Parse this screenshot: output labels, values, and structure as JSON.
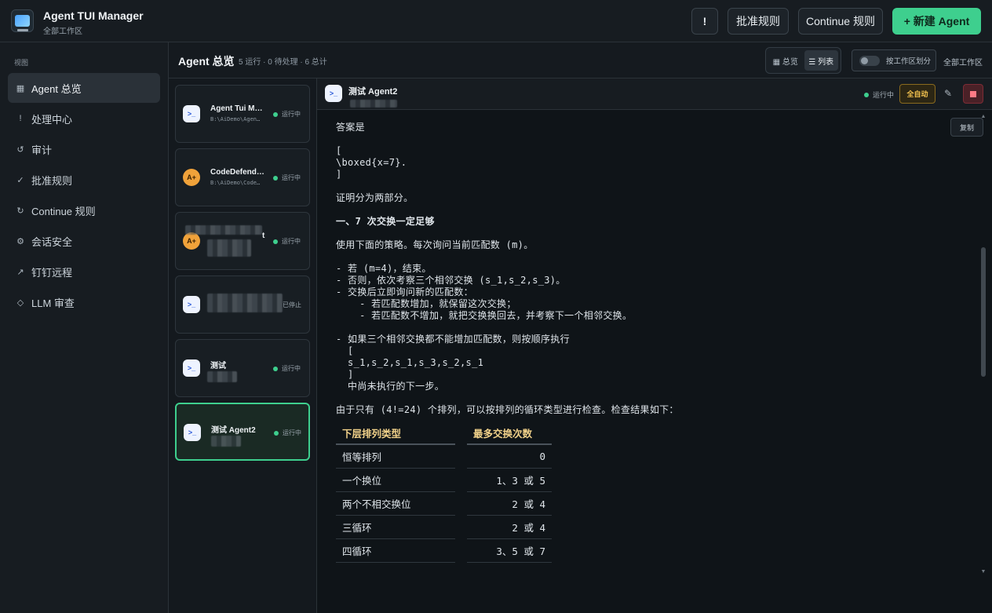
{
  "app": {
    "title": "Agent TUI Manager",
    "subtitle": "全部工作区",
    "logo_icon": "terminal-monitor-icon"
  },
  "topbar": {
    "alert_label": "!",
    "approve_rules_label": "批准规则",
    "continue_rules_label": "Continue 规则",
    "new_agent_label": "+ 新建 Agent",
    "accent": "#3ecf8e"
  },
  "sidebar": {
    "caption": "视图",
    "items": [
      {
        "icon": "▦",
        "label": "Agent 总览",
        "active": true
      },
      {
        "icon": "!",
        "label": "处理中心"
      },
      {
        "icon": "↺",
        "label": "审计"
      },
      {
        "icon": "✓",
        "label": "批准规则"
      },
      {
        "icon": "↻",
        "label": "Continue 规则"
      },
      {
        "icon": "⚙",
        "label": "会话安全"
      },
      {
        "icon": "↗",
        "label": "钉钉远程"
      },
      {
        "icon": "◇",
        "label": "LLM 审查"
      }
    ]
  },
  "list_header": {
    "title": "Agent 总览",
    "stats": "5 运行 · 0 待处理 · 6 总计",
    "view_overview": "▦ 总览",
    "view_list": "☰ 列表",
    "workspace_toggle": "按工作区划分",
    "workspace_all": "全部工作区"
  },
  "agents": [
    {
      "name": "Agent Tui M…",
      "path": "B:\\AiDemo\\Agen…",
      "status": "运行中",
      "icon": "terminal-icon"
    },
    {
      "name": "CodeDefend…",
      "path": "B:\\AiDemo\\Code…",
      "status": "运行中",
      "icon": "aplus-icon"
    },
    {
      "name": "t",
      "path": "",
      "status": "运行中",
      "icon": "aplus-icon"
    },
    {
      "name": "",
      "path": "",
      "status": "已停止",
      "icon": "terminal-icon"
    },
    {
      "name": "测试",
      "path": "",
      "status": "运行中",
      "icon": "terminal-icon"
    },
    {
      "name": "测试 Agent2",
      "path": "",
      "status": "运行中",
      "icon": "terminal-icon",
      "selected": true
    }
  ],
  "detail": {
    "name": "测试 Agent2",
    "status": "运行中",
    "mode_badge": "全自动",
    "copy_label": "复制",
    "lines": [
      "答案是",
      "[",
      "\\boxed{x=7}.",
      "]",
      "证明分为两部分。",
      "一、7 次交换一定足够",
      "使用下面的策略。每次询问当前匹配数 (m)。",
      "- 若 (m=4)，结束。",
      "- 否则，依次考察三个相邻交换 (s_1,s_2,s_3)。",
      "- 交换后立即询问新的匹配数：",
      "    - 若匹配数增加，就保留这次交换；",
      "    - 若匹配数不增加，就把交换换回去，并考察下一个相邻交换。",
      "- 如果三个相邻交换都不能增加匹配数，则按顺序执行",
      "  [",
      "  s_1,s_2,s_1,s_3,s_2,s_1",
      "  ]",
      "  中尚未执行的下一步。",
      "由于只有 (4!=24) 个排列，可以按排列的循环类型进行检查。检查结果如下："
    ],
    "table": {
      "headers": [
        "下层排列类型",
        "最多交换次数"
      ],
      "rows": [
        [
          "恒等排列",
          "0"
        ],
        [
          "一个换位",
          "1、3 或 5"
        ],
        [
          "两个不相交换位",
          "2 或 4"
        ],
        [
          "三循环",
          "2 或 4"
        ],
        [
          "四循环",
          "3、5 或 7"
        ]
      ]
    }
  }
}
